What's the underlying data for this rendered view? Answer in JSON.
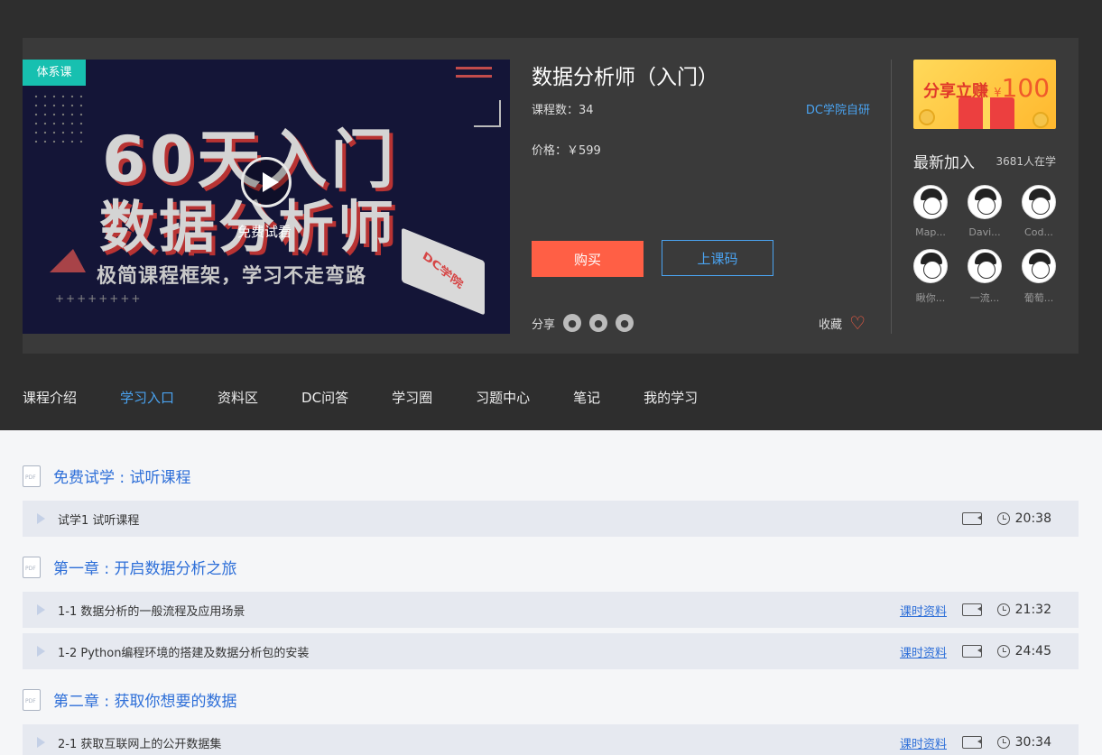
{
  "cover": {
    "tag": "体系课",
    "headline1": "60天入门",
    "headline2": "数据分析师",
    "slogan": "极简课程框架，学习不走弯路",
    "logo_text": "DC学院",
    "pluses": "++++++++",
    "trial_label": "免费试看"
  },
  "course": {
    "title": "数据分析师（入门）",
    "lessons_label": "课程数：34",
    "author": "DC学院自研",
    "price_label": "价格：￥599",
    "buy_label": "购买",
    "code_label": "上课码",
    "share_label": "分享",
    "fav_label": "收藏"
  },
  "banner": {
    "text": "分享立赚",
    "amount": "100",
    "currency": "¥"
  },
  "learners": {
    "title": "最新加入",
    "count_label": "3681人在学",
    "users": [
      "Map...",
      "Davi...",
      "Cod...",
      "瞅你...",
      "一流...",
      "葡萄..."
    ]
  },
  "nav": {
    "tabs": [
      "课程介绍",
      "学习入口",
      "资料区",
      "DC问答",
      "学习圈",
      "习题中心",
      "笔记",
      "我的学习"
    ],
    "active": "学习入口"
  },
  "chapters": [
    {
      "title": "免费试学 : 试听课程",
      "lessons": [
        {
          "title": "试学1 试听课程",
          "resource": "",
          "duration": "20:38"
        }
      ]
    },
    {
      "title": "第一章 : 开启数据分析之旅",
      "lessons": [
        {
          "title": "1-1 数据分析的一般流程及应用场景",
          "resource": "课时资料",
          "duration": "21:32"
        },
        {
          "title": "1-2 Python编程环境的搭建及数据分析包的安装",
          "resource": "课时资料",
          "duration": "24:45"
        }
      ]
    },
    {
      "title": "第二章 : 获取你想要的数据",
      "lessons": [
        {
          "title": "2-1 获取互联网上的公开数据集",
          "resource": "课时资料",
          "duration": "30:34"
        }
      ]
    }
  ],
  "colors": {
    "accent": "#4aa3f0",
    "buy": "#ff5f45",
    "tag": "#17c0b0",
    "link": "#2e6fd8"
  }
}
